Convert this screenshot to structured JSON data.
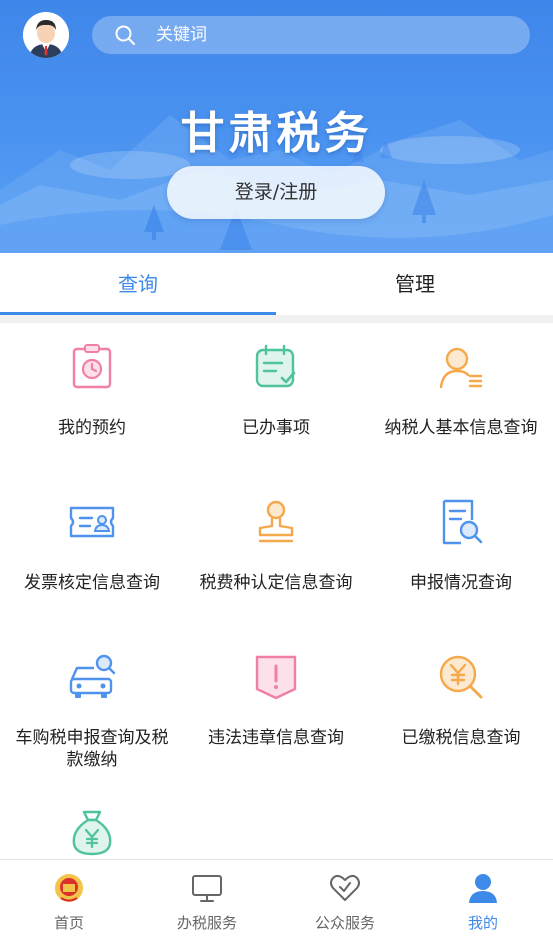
{
  "header": {
    "search_placeholder": "关键词",
    "title": "甘肃税务",
    "login_label": "登录/注册"
  },
  "tabs": [
    {
      "label": "查询",
      "active": true
    },
    {
      "label": "管理",
      "active": false
    }
  ],
  "grid": {
    "items": [
      {
        "label": "我的预约",
        "icon": "appointment-clock-icon",
        "color": "#f07fa6"
      },
      {
        "label": "已办事项",
        "icon": "completed-checklist-icon",
        "color": "#4fc39a"
      },
      {
        "label": "纳税人基本信息查询",
        "icon": "taxpayer-info-icon",
        "color": "#f5a94a"
      },
      {
        "label": "发票核定信息查询",
        "icon": "invoice-icon",
        "color": "#4f93ee"
      },
      {
        "label": "税费种认定信息查询",
        "icon": "stamp-icon",
        "color": "#f5a94a"
      },
      {
        "label": "申报情况查询",
        "icon": "document-search-icon",
        "color": "#4f93ee"
      },
      {
        "label": "车购税申报查询及税款缴纳",
        "icon": "car-search-icon",
        "color": "#4f93ee"
      },
      {
        "label": "违法违章信息查询",
        "icon": "warning-shield-icon",
        "color": "#f07fa6"
      },
      {
        "label": "已缴税信息查询",
        "icon": "yuan-search-icon",
        "color": "#f5a94a"
      },
      {
        "label": "",
        "icon": "money-bag-icon",
        "color": "#4fc39a"
      }
    ]
  },
  "bottom_nav": [
    {
      "label": "首页",
      "icon": "tax-emblem-icon",
      "active": false
    },
    {
      "label": "办税服务",
      "icon": "monitor-icon",
      "active": false
    },
    {
      "label": "公众服务",
      "icon": "heart-icon",
      "active": false
    },
    {
      "label": "我的",
      "icon": "user-icon",
      "active": true
    }
  ],
  "colors": {
    "accent": "#3d8ae8",
    "header_blue": "#4b93f0"
  }
}
